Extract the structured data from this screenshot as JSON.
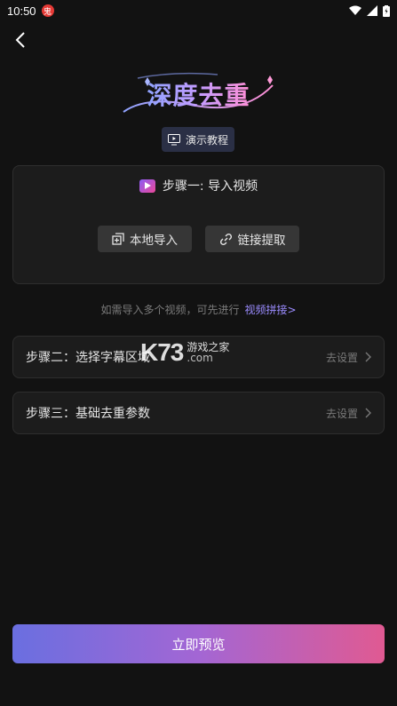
{
  "status_bar": {
    "time": "10:50",
    "notification_badge": "鬼"
  },
  "header": {
    "title": "深度去重",
    "tutorial_label": "演示教程"
  },
  "step1": {
    "title": "步骤一: 导入视频",
    "local_import_label": "本地导入",
    "link_extract_label": "链接提取"
  },
  "hint": {
    "text": "如需导入多个视频，可先进行",
    "link": "视频拼接>"
  },
  "step2": {
    "label": "步骤二：选择字幕区域",
    "action": "去设置"
  },
  "step3": {
    "label": "步骤三：基础去重参数",
    "action": "去设置"
  },
  "watermark": {
    "main": "K73",
    "top": "游戏之家",
    "bottom": ".com"
  },
  "footer": {
    "preview_label": "立即预览"
  },
  "colors": {
    "accent_start": "#6a6fe0",
    "accent_end": "#e05a92",
    "link": "#9b8cff"
  }
}
